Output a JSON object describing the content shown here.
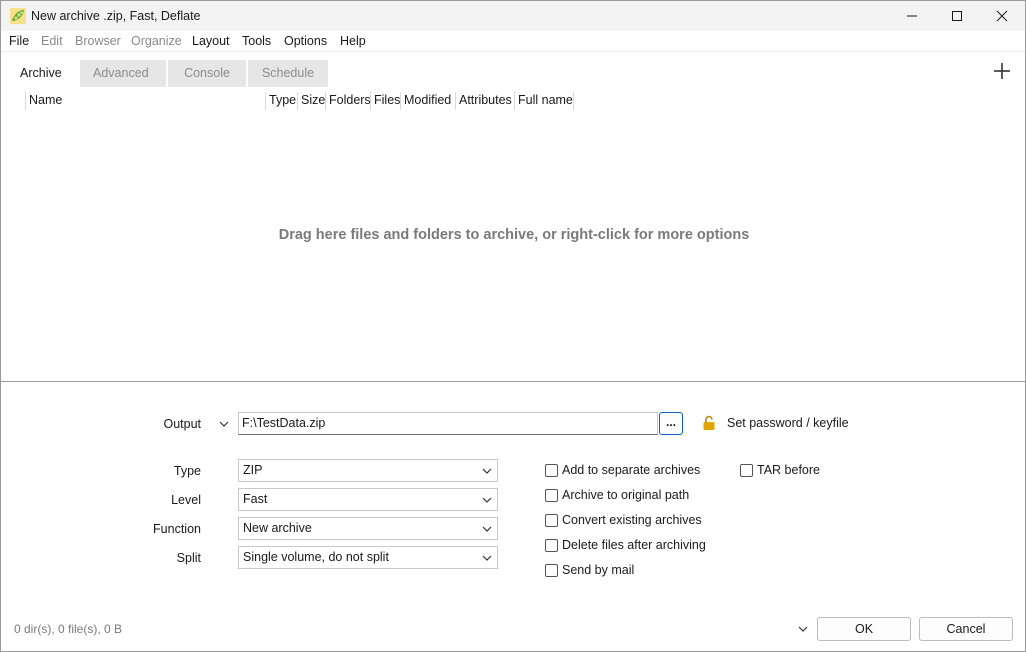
{
  "window": {
    "title": "New archive .zip, Fast, Deflate"
  },
  "menu": [
    "File",
    "Edit",
    "Browser",
    "Organize",
    "Layout",
    "Tools",
    "Options",
    "Help"
  ],
  "tabs": [
    "Archive",
    "Advanced",
    "Console",
    "Schedule"
  ],
  "columns": [
    "Name",
    "Type",
    "Size",
    "Folders",
    "Files",
    "Modified",
    "Attributes",
    "Full name"
  ],
  "drop_hint": "Drag here files and folders to archive, or right-click for more options",
  "output": {
    "label": "Output",
    "value": "F:\\TestData.zip",
    "browse": "...",
    "password_link": "Set password / keyfile"
  },
  "fields": {
    "type": {
      "label": "Type",
      "value": "ZIP"
    },
    "level": {
      "label": "Level",
      "value": "Fast"
    },
    "function": {
      "label": "Function",
      "value": "New archive"
    },
    "split": {
      "label": "Split",
      "value": "Single volume, do not split"
    }
  },
  "options": [
    {
      "label": "Add to separate archives",
      "checked": false
    },
    {
      "label": "Archive to original path",
      "checked": false
    },
    {
      "label": "Convert existing archives",
      "checked": false
    },
    {
      "label": "Delete files after archiving",
      "checked": false
    },
    {
      "label": "Send by mail",
      "checked": false
    }
  ],
  "tar_before": {
    "label": "TAR before",
    "checked": false
  },
  "status": "0 dir(s), 0 file(s), 0 B",
  "buttons": {
    "ok": "OK",
    "cancel": "Cancel"
  },
  "colors": {
    "accent": "#0a64c8",
    "lock": "#e2a400",
    "icon_green": "#6aa52c"
  }
}
